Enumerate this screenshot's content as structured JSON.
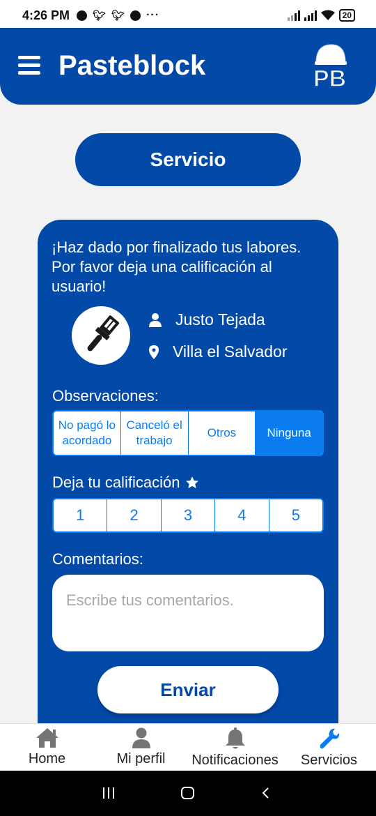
{
  "status_bar": {
    "time": "4:26 PM",
    "battery": "20",
    "icons": [
      "alarm-icon",
      "twitter-icon",
      "twitter-icon",
      "check-circle-icon",
      "more-dots-icon",
      "signal-icon",
      "signal-icon",
      "wifi-icon",
      "battery-icon"
    ]
  },
  "header": {
    "title": "Pasteblock",
    "menu_icon": "hamburger-menu-icon",
    "logo_icon": "pasteblock-logo-icon",
    "logo_text": "PB"
  },
  "page_title": "Servicio",
  "card": {
    "intro_text": "¡Haz dado por finalizado tus labores. Por favor deja una calificación al usuario!",
    "avatar_icon": "paint-brush-icon",
    "user_name": "Justo Tejada",
    "user_icon": "person-icon",
    "location": "Villa el Salvador",
    "location_icon": "map-pin-icon",
    "observations_label": "Observaciones:",
    "observations": [
      {
        "label": "No pagó lo acordado",
        "selected": false
      },
      {
        "label": "Canceló el trabajo",
        "selected": false
      },
      {
        "label": "Otros",
        "selected": false
      },
      {
        "label": "Ninguna",
        "selected": true
      }
    ],
    "rating_label": "Deja tu calificación",
    "rating_icon": "star-icon",
    "ratings": [
      "1",
      "2",
      "3",
      "4",
      "5"
    ],
    "comments_label": "Comentarios:",
    "comments_placeholder": "Escribe tus comentarios.",
    "comments_value": "",
    "submit_label": "Enviar"
  },
  "bottom_nav": [
    {
      "label": "Home",
      "icon": "home-icon",
      "active": false
    },
    {
      "label": "Mi perfil",
      "icon": "person-icon",
      "active": false
    },
    {
      "label": "Notificaciones",
      "icon": "bell-icon",
      "active": false
    },
    {
      "label": "Servicios",
      "icon": "wrench-icon",
      "active": true
    }
  ],
  "colors": {
    "primary": "#0349a8",
    "accent": "#0b7cf0",
    "background": "#f2f2f2",
    "nav_inactive": "#757575"
  }
}
